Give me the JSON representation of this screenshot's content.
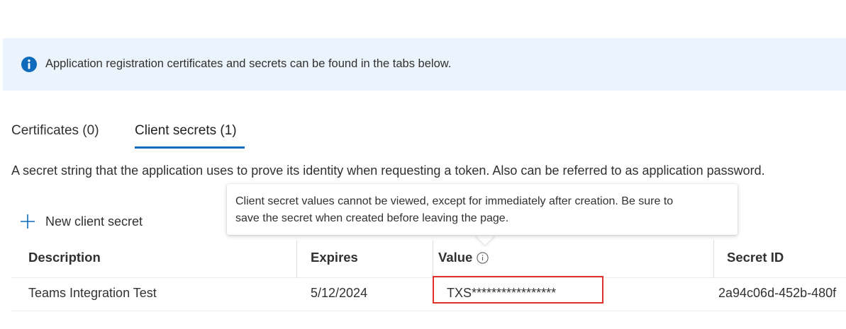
{
  "banner": {
    "icon": "info-icon",
    "text": "Application registration certificates and secrets can be found in the tabs below."
  },
  "tabs": [
    {
      "label": "Certificates (0)",
      "selected": false
    },
    {
      "label": "Client secrets (1)",
      "selected": true
    }
  ],
  "description": "A secret string that the application uses to prove its identity when requesting a token. Also can be referred to as application password.",
  "toolbar": {
    "new_secret_label": "New client secret",
    "new_secret_icon": "plus-icon"
  },
  "tooltip": {
    "line1": "Client secret values cannot be viewed, except for immediately after creation. Be sure to",
    "line2": "save the secret when created before leaving the page."
  },
  "table": {
    "columns": [
      "Description",
      "Expires",
      "Value",
      "Secret ID"
    ],
    "rows": [
      {
        "description": "Teams Integration Test",
        "expires": "5/12/2024",
        "value": "TXS*****************",
        "secret_id": "2a94c06d-452b-480f"
      }
    ]
  },
  "colors": {
    "accent": "#0f6cbd",
    "banner_bg": "#ebf3fc",
    "highlight": "#e0302b"
  }
}
